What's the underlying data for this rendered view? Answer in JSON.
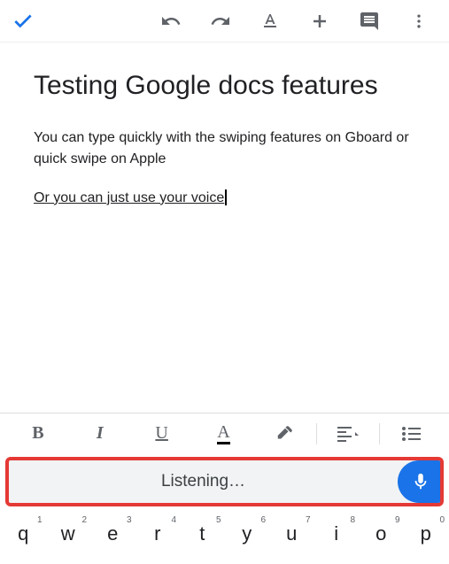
{
  "toolbar": {
    "check": "done-check",
    "undo": "undo",
    "redo": "redo",
    "textformat": "text-format",
    "insert": "insert",
    "comment": "comment",
    "more": "more"
  },
  "document": {
    "title": "Testing Google docs features",
    "paragraph": "You can type quickly with the swiping features on Gboard or quick swipe on Apple",
    "underlined": "Or you can just use your voice"
  },
  "format": {
    "bold": "B",
    "italic": "I",
    "underline": "U",
    "textcolor": "A",
    "highlight": "highlight",
    "align": "align",
    "list": "list"
  },
  "voice": {
    "status": "Listening…"
  },
  "keyboard": {
    "keys": [
      {
        "letter": "q",
        "num": "1"
      },
      {
        "letter": "w",
        "num": "2"
      },
      {
        "letter": "e",
        "num": "3"
      },
      {
        "letter": "r",
        "num": "4"
      },
      {
        "letter": "t",
        "num": "5"
      },
      {
        "letter": "y",
        "num": "6"
      },
      {
        "letter": "u",
        "num": "7"
      },
      {
        "letter": "i",
        "num": "8"
      },
      {
        "letter": "o",
        "num": "9"
      },
      {
        "letter": "p",
        "num": "0"
      }
    ]
  }
}
